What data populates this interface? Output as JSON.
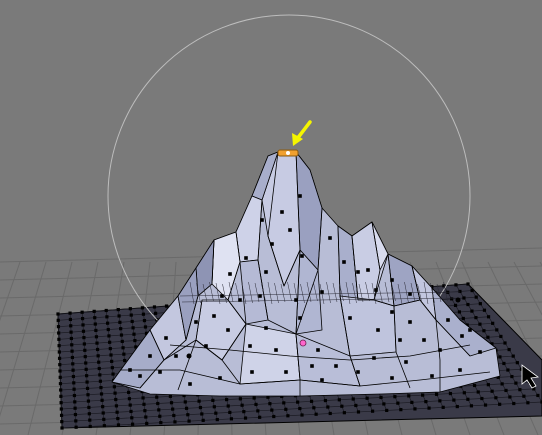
{
  "app": {
    "name": "3D Viewport",
    "background_color": "#7a7a7a"
  },
  "scene": {
    "mode": "edit",
    "object_type": "mesh",
    "selection": "single-vertex",
    "proportional_editing": "enabled",
    "colors": {
      "grid_line": "#6a6a6a",
      "mesh_face": "#b8bdd6",
      "mesh_face_shadow": "#8e94b4",
      "mesh_edge": "#000000",
      "vertex": "#000000",
      "selected_vertex": "#f0a030",
      "influence_circle": "#bdbdbd",
      "annotation_arrow": "#f5f500",
      "object_origin": "#ff66cc"
    },
    "icons": {
      "arrow": "pointer-arrow-icon",
      "cursor": "mouse-cursor-icon"
    }
  }
}
